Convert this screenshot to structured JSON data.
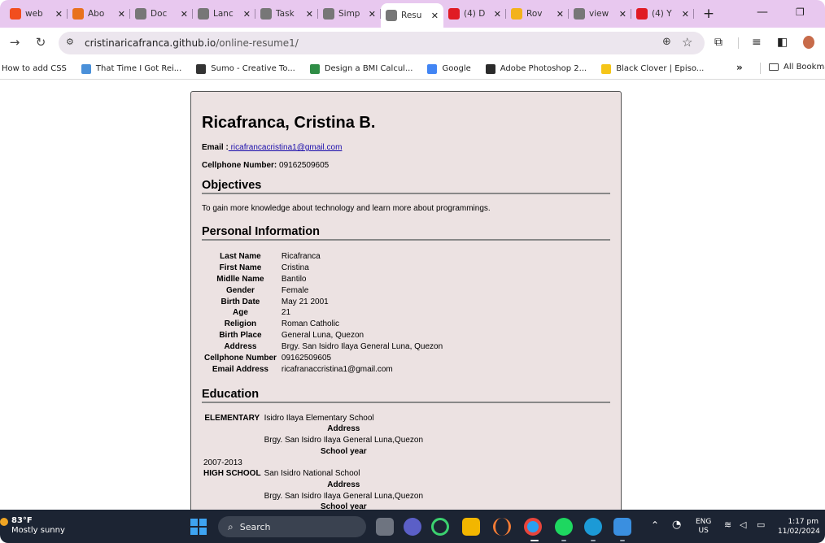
{
  "browser": {
    "tabs": [
      {
        "title": "web",
        "icon": "figma-icon",
        "color": "#f24e1e"
      },
      {
        "title": "Abo",
        "icon": "canva-icon",
        "color": "#e8711d"
      },
      {
        "title": "Doc",
        "icon": "globe-icon",
        "color": "#777777"
      },
      {
        "title": "Lanc",
        "icon": "globe-icon",
        "color": "#777777"
      },
      {
        "title": "Task",
        "icon": "globe-icon",
        "color": "#777777"
      },
      {
        "title": "Simp",
        "icon": "globe-icon",
        "color": "#777777"
      },
      {
        "title": "Resu",
        "icon": "globe-icon",
        "color": "#777777",
        "active": true
      },
      {
        "title": "(4) D",
        "icon": "youtube-icon",
        "color": "#e01b24"
      },
      {
        "title": "Rov",
        "icon": "rover-icon",
        "color": "#f3b21b"
      },
      {
        "title": "view",
        "icon": "globe-icon",
        "color": "#777777"
      },
      {
        "title": "(4) Y",
        "icon": "youtube-icon",
        "color": "#e01b24"
      }
    ],
    "url_host": "cristinaricafranca.github.io",
    "url_path": "/online-resume1/",
    "bookmarks": [
      {
        "label": "How to add CSS",
        "icon": "none",
        "color": "#ffffff"
      },
      {
        "label": "That Time I Got Rei...",
        "icon": "tv-icon",
        "color": "#4a90d9"
      },
      {
        "label": "Sumo - Creative To...",
        "icon": "sumo-icon",
        "color": "#333333"
      },
      {
        "label": "Design a BMI Calcul...",
        "icon": "gfg-icon",
        "color": "#2f8d46"
      },
      {
        "label": "Google",
        "icon": "google-icon",
        "color": "#4285f4"
      },
      {
        "label": "Adobe Photoshop 2...",
        "icon": "getintopc-icon",
        "color": "#2b2b2b"
      },
      {
        "label": "Black Clover | Episo...",
        "icon": "play-icon",
        "color": "#f5c518"
      }
    ],
    "more_bookmarks": "»",
    "all_bookmarks": "All Bookma"
  },
  "resume": {
    "name": "Ricafranca, Cristina B.",
    "email_label": "Email :",
    "email": " ricafrancacristina1@gmail.com",
    "cell_label": "Cellphone Number:",
    "cell": " 09162509605",
    "objectives_heading": "Objectives",
    "objectives_text": "To gain more knowledge about technology and learn more about programmings.",
    "personal_heading": "Personal Information",
    "personal": [
      {
        "k": "Last Name",
        "v": "Ricafranca"
      },
      {
        "k": "First Name",
        "v": "Cristina"
      },
      {
        "k": "Midlle Name",
        "v": "Bantilo"
      },
      {
        "k": "Gender",
        "v": "Female"
      },
      {
        "k": "Birth Date",
        "v": "May 21 2001"
      },
      {
        "k": "Age",
        "v": "21"
      },
      {
        "k": "Religion",
        "v": "Roman Catholic"
      },
      {
        "k": "Birth Place",
        "v": "General Luna, Quezon"
      },
      {
        "k": "Address",
        "v": "Brgy. San Isidro Ilaya General Luna, Quezon"
      },
      {
        "k": "Cellphone Number",
        "v": "09162509605"
      },
      {
        "k": "Email Address",
        "v": "ricafranaccristina1@gmail.com"
      }
    ],
    "education_heading": "Education",
    "education": [
      {
        "level": "ELEMENTARY",
        "school": "Isidro Ilaya Elementary School",
        "address_label": "Address",
        "address": "Brgy. San Isidro Ilaya General Luna,Quezon",
        "year_label": "School year",
        "year": "2007-2013"
      },
      {
        "level": "HIGH SCHOOL",
        "school": "San Isidro National School",
        "address_label": "Address",
        "address": "Brgy. San Isidro Ilaya General Luna,Quezon",
        "year_label": "School year",
        "year": ""
      }
    ]
  },
  "taskbar": {
    "temp": "83°F",
    "weather": "Mostly sunny",
    "search": "Search",
    "lang1": "ENG",
    "lang2": "US",
    "time": "1:17 pm",
    "date": "11/02/2024"
  }
}
